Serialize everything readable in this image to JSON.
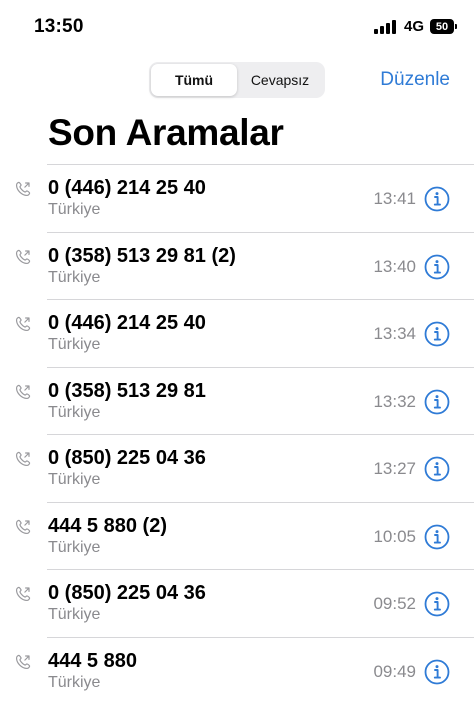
{
  "status_bar": {
    "time": "13:50",
    "network": "4G",
    "battery": "50"
  },
  "tabs": [
    {
      "label": "Tümü",
      "selected": true
    },
    {
      "label": "Cevapsız",
      "selected": false
    }
  ],
  "edit_label": "Düzenle",
  "title": "Son Aramalar",
  "accent_color": "#2f7bd6",
  "icons": {
    "call_type": "outgoing-call-icon",
    "info": "info-circle-icon"
  },
  "calls": [
    {
      "number": "0 (446) 214 25 40",
      "location": "Türkiye",
      "time": "13:41"
    },
    {
      "number": "0 (358) 513 29 81 (2)",
      "location": "Türkiye",
      "time": "13:40"
    },
    {
      "number": "0 (446) 214 25 40",
      "location": "Türkiye",
      "time": "13:34"
    },
    {
      "number": "0 (358) 513 29 81",
      "location": "Türkiye",
      "time": "13:32"
    },
    {
      "number": "0 (850) 225 04 36",
      "location": "Türkiye",
      "time": "13:27"
    },
    {
      "number": "444 5 880 (2)",
      "location": "Türkiye",
      "time": "10:05"
    },
    {
      "number": "0 (850) 225 04 36",
      "location": "Türkiye",
      "time": "09:52"
    },
    {
      "number": "444 5 880",
      "location": "Türkiye",
      "time": "09:49"
    }
  ]
}
